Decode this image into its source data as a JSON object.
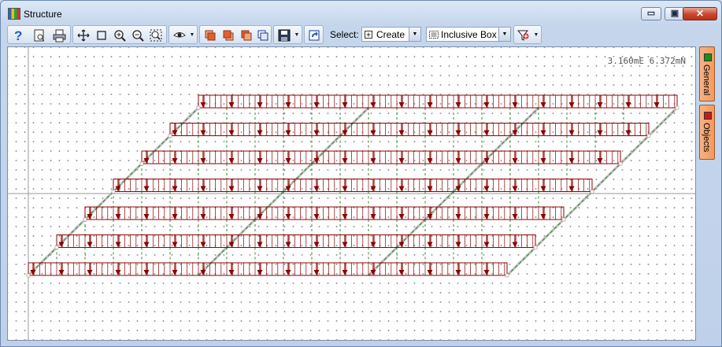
{
  "window": {
    "title": "Structure",
    "minimize_glyph": "▭",
    "maximize_glyph": "▣",
    "close_glyph": "✕"
  },
  "toolbar": {
    "select_label": "Select:",
    "mode_value": "Create",
    "box_value": "Inclusive Box",
    "icons": [
      "help-icon",
      "print-preview-icon",
      "print-icon",
      "pan-icon",
      "select-rect-icon",
      "zoom-in-icon",
      "zoom-out-icon",
      "zoom-extents-icon",
      "view-icon",
      "layer1-icon",
      "layer2-icon",
      "layer3-icon",
      "layer4-icon",
      "save-icon",
      "refresh-icon",
      "filter-icon"
    ]
  },
  "canvas": {
    "coordinate_readout": "3.160mE 6.372mN"
  },
  "side_tabs": [
    {
      "label": "General",
      "color": "#1a8f1a"
    },
    {
      "label": "Objects",
      "color": "#c41c1c"
    }
  ],
  "colors": {
    "load": "#8b0000",
    "member": "#bdbdbd",
    "dash": "#2e8b2e",
    "axis": "#9a9a9a"
  }
}
